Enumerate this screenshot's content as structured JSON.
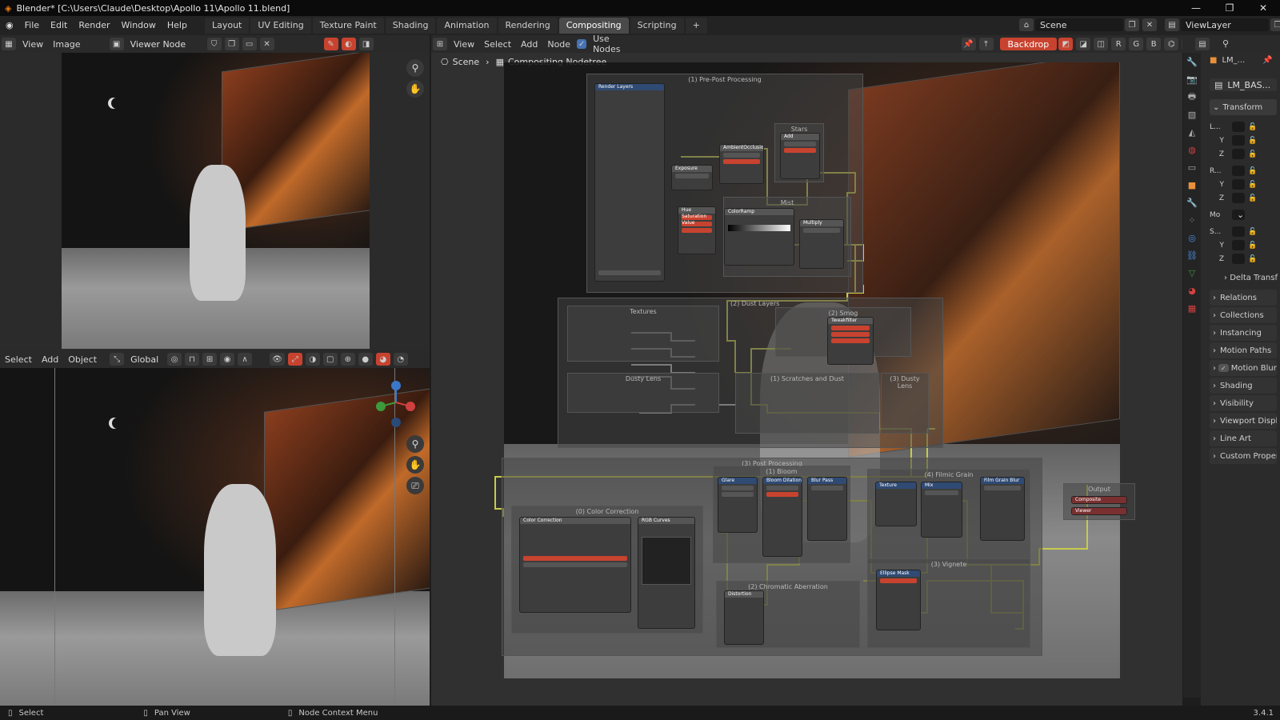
{
  "window": {
    "title": "Blender* [C:\\Users\\Claude\\Desktop\\Apollo 11\\Apollo 11.blend]",
    "controls": [
      "—",
      "❐",
      "✕"
    ]
  },
  "menu": [
    "File",
    "Edit",
    "Render",
    "Window",
    "Help"
  ],
  "workspaces": [
    {
      "label": "Layout",
      "active": false
    },
    {
      "label": "UV Editing",
      "active": false
    },
    {
      "label": "Texture Paint",
      "active": false
    },
    {
      "label": "Shading",
      "active": false
    },
    {
      "label": "Animation",
      "active": false
    },
    {
      "label": "Rendering",
      "active": false
    },
    {
      "label": "Compositing",
      "active": true
    },
    {
      "label": "Scripting",
      "active": false
    }
  ],
  "scene": {
    "name": "Scene",
    "view_layer": "ViewLayer"
  },
  "image_editor": {
    "menu": [
      "View",
      "Image"
    ],
    "image_name": "Viewer Node"
  },
  "viewport3d": {
    "menu": [
      "Select",
      "Add",
      "Object"
    ],
    "orientation": "Global"
  },
  "node_editor": {
    "menu": [
      "View",
      "Select",
      "Add",
      "Node"
    ],
    "use_nodes_label": "Use Nodes",
    "use_nodes": true,
    "backdrop_label": "Backdrop",
    "channels": [
      "R",
      "G",
      "B"
    ],
    "breadcrumb": [
      "Scene",
      "Compositing Nodetree"
    ],
    "frames": {
      "pre_post": "(1) Pre-Post Processing",
      "stars": "Stars",
      "mist": "Mist",
      "dust_layers": "(2) Dust Layers",
      "textures": "Textures",
      "smog": "(2) Smog",
      "dusty_lens": "Dusty Lens",
      "scratches": "(1) Scratches and Dust",
      "dusty_lens3": "(3) Dusty Lens",
      "post_processing": "(3) Post Processing",
      "color_correction": "(0) Color Correction",
      "bloom": "(1) Bloom",
      "filmic": "(4) Filmic Grain",
      "vignette": "(3) Vignete",
      "chroma": "(2) Chromatic Aberration",
      "output": "Output"
    },
    "nodes": {
      "render_layers": "Render Layers",
      "exposure": "Exposure",
      "ambient": "AmbientOcclusion",
      "add": "Add",
      "hue_sat": "Hue Saturation Value",
      "color_ramp": "ColorRamp",
      "multiply": "Multiply",
      "tweakmix": "Tweakfilter",
      "color_corr": "Color Correction",
      "rgb_curves": "RGB Curves",
      "glare": "Glare",
      "bloom_dil": "Bloom Dilation",
      "blur": "Blur Pass",
      "texture": "Texture",
      "mix": "Mix",
      "film_blur": "Film Grain Blur",
      "composite": "Composite",
      "viewer": "Viewer",
      "distortion": "Distortion",
      "ellipse": "Ellipse Mask"
    }
  },
  "properties": {
    "object_name": "LM_...",
    "mesh_name": "LM_BAS...",
    "transform_label": "Transform",
    "rows": [
      {
        "l": "L...",
        "v": ""
      },
      {
        "l": "Y",
        "v": ""
      },
      {
        "l": "Z",
        "v": ""
      },
      {
        "l": "R...",
        "v": ""
      },
      {
        "l": "Y",
        "v": ""
      },
      {
        "l": "Z",
        "v": ""
      },
      {
        "l": "Mo",
        "v": ""
      },
      {
        "l": "S...",
        "v": ""
      },
      {
        "l": "Y",
        "v": ""
      },
      {
        "l": "Z",
        "v": ""
      }
    ],
    "delta": "Delta Transf",
    "sections": [
      "Relations",
      "Collections",
      "Instancing",
      "Motion Paths",
      "Motion Blur",
      "Shading",
      "Visibility",
      "Viewport Displ",
      "Line Art",
      "Custom Proper"
    ]
  },
  "status": {
    "left": "Select",
    "mid": "Pan View",
    "right": "Node Context Menu",
    "version": "3.4.1"
  }
}
